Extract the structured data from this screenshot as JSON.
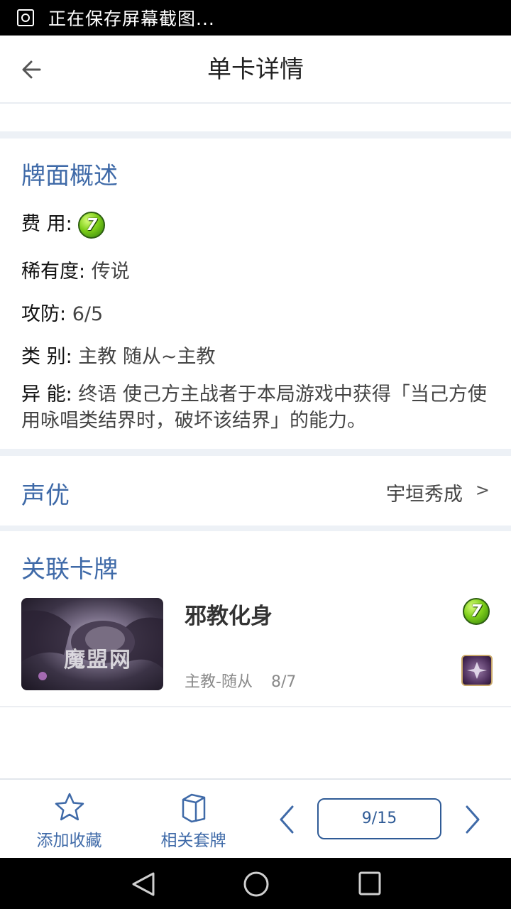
{
  "status_bar": {
    "text": "正在保存屏幕截图..."
  },
  "app_bar": {
    "title": "单卡详情"
  },
  "overview": {
    "title": "牌面概述",
    "cost_label": "费 用:",
    "cost_value": "7",
    "rarity_label": "稀有度:",
    "rarity_value": "传说",
    "stats_label": "攻防:",
    "stats_value": "6/5",
    "type_label": "类 别:",
    "type_value": "主教 随从~主教",
    "ability_label": "异 能:",
    "ability_value": "终语 使己方主战者于本局游戏中获得「当己方使用咏唱类结界时，破坏该结界」的能力。"
  },
  "voice_actor": {
    "title": "声优",
    "name": "宇垣秀成",
    "chevron": ">"
  },
  "related": {
    "title": "关联卡牌",
    "cards": [
      {
        "name": "邪教化身",
        "type": "主教-随从",
        "stats": "8/7",
        "cost": "7",
        "watermark": "魔盟网"
      }
    ]
  },
  "bottom_bar": {
    "favorite_label": "添加收藏",
    "decks_label": "相关套牌",
    "pager": "9/15"
  },
  "icons": {
    "back": "arrow-left-icon",
    "favorite": "star-icon",
    "decks": "box-icon",
    "prev": "chevron-left-icon",
    "next": "chevron-right-icon",
    "class": "bishop-class-icon",
    "nav_back": "triangle-back-icon",
    "nav_home": "circle-home-icon",
    "nav_recent": "square-recent-icon"
  },
  "colors": {
    "accent": "#3f6aa8",
    "section_gap": "#edf1f6",
    "cost_gem": "#7fcf1a"
  }
}
